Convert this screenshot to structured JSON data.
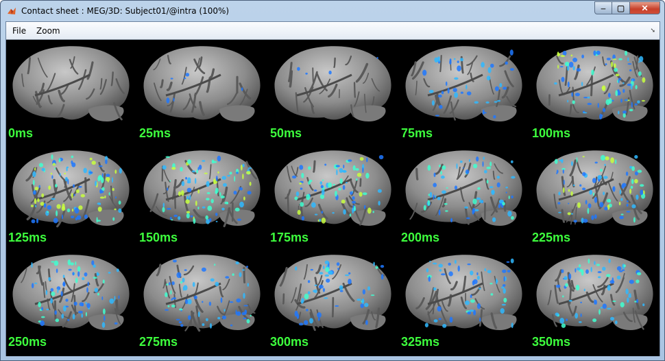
{
  "window": {
    "title": "Contact sheet : MEG/3D: Subject01/@intra (100%)",
    "controls": {
      "minimize": "‒",
      "maximize": "▢",
      "close": "✕"
    }
  },
  "menu": {
    "file": "File",
    "zoom": "Zoom"
  },
  "contact_sheet": {
    "frames": [
      {
        "label": "0ms",
        "activation": 0.0
      },
      {
        "label": "25ms",
        "activation": 0.05
      },
      {
        "label": "50ms",
        "activation": 0.03
      },
      {
        "label": "75ms",
        "activation": 0.35
      },
      {
        "label": "100ms",
        "activation": 0.7
      },
      {
        "label": "125ms",
        "activation": 0.85
      },
      {
        "label": "150ms",
        "activation": 0.75
      },
      {
        "label": "175ms",
        "activation": 0.65
      },
      {
        "label": "200ms",
        "activation": 0.55
      },
      {
        "label": "225ms",
        "activation": 0.7
      },
      {
        "label": "250ms",
        "activation": 0.6
      },
      {
        "label": "275ms",
        "activation": 0.5
      },
      {
        "label": "300ms",
        "activation": 0.45
      },
      {
        "label": "325ms",
        "activation": 0.45
      },
      {
        "label": "350ms",
        "activation": 0.55
      }
    ],
    "label_color": "#3dff3d",
    "cortex_color": "#8c8c8c",
    "activation_colors": [
      "#1e78ff",
      "#2fb8ff",
      "#3fffd0",
      "#c8ff40"
    ]
  }
}
